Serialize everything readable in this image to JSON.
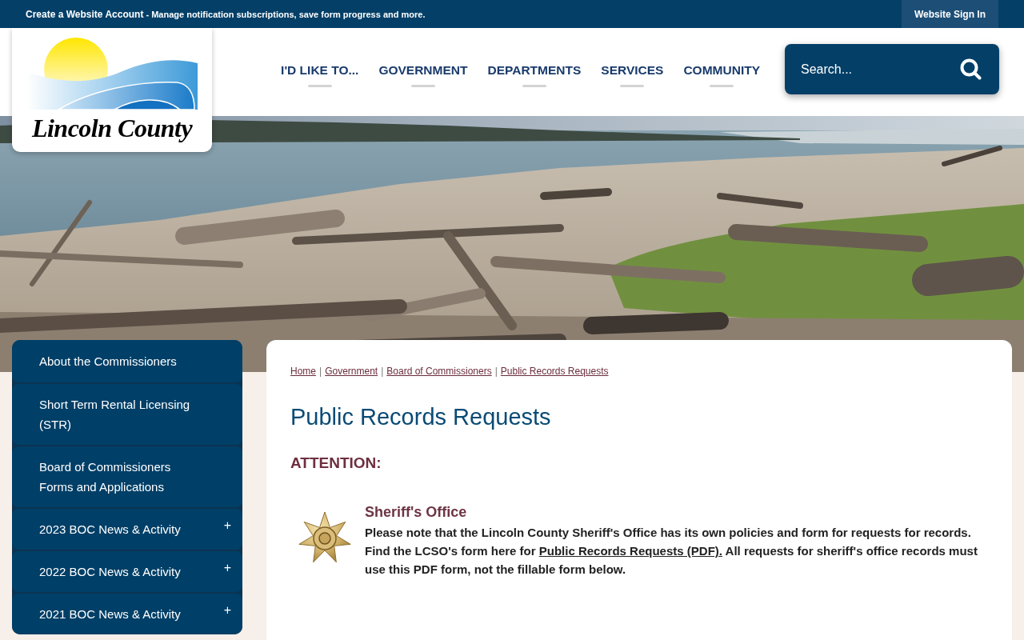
{
  "top_bar": {
    "account_link": "Create a Website Account",
    "message": " - Manage notification subscriptions, save form progress and more.",
    "sign_in": "Website Sign In"
  },
  "header": {
    "logo_text": "Lincoln County",
    "nav": [
      "I'D LIKE TO...",
      "GOVERNMENT",
      "DEPARTMENTS",
      "SERVICES",
      "COMMUNITY"
    ],
    "search": {
      "placeholder": "Search..."
    }
  },
  "sidebar": {
    "items": [
      {
        "kind": "link",
        "label": "About the Commissioners"
      },
      {
        "kind": "link",
        "label": "Short Term Rental Licensing (STR)"
      },
      {
        "kind": "link",
        "label": "Board of Commissioners Forms and Applications"
      },
      {
        "kind": "group",
        "label": "2023 BOC News & Activity",
        "toggle": "+"
      },
      {
        "kind": "group",
        "label": "2022 BOC News & Activity",
        "toggle": "+"
      },
      {
        "kind": "group",
        "label": "2021 BOC News & Activity",
        "toggle": "+"
      }
    ]
  },
  "content": {
    "breadcrumb": [
      {
        "kind": "link",
        "label": "Home"
      },
      {
        "kind": "separator",
        "label": "|"
      },
      {
        "kind": "link",
        "label": "Government"
      },
      {
        "kind": "separator",
        "label": "|"
      },
      {
        "kind": "link",
        "label": "Board of Commissioners"
      },
      {
        "kind": "separator",
        "label": "|"
      },
      {
        "kind": "link",
        "label": "Public Records Requests"
      }
    ],
    "title": "Public Records Requests",
    "attention": "ATTENTION:",
    "notice": {
      "heading": "Sheriff's Office",
      "text_before": "Please note that the Lincoln County Sheriff's Office has its own policies and form for requests for records. Find the LCSO's form here for ",
      "link": "Public Records Requests (PDF).",
      "text_after": " All requests for sheriff's office records must use this PDF form, not the fillable form below."
    }
  }
}
